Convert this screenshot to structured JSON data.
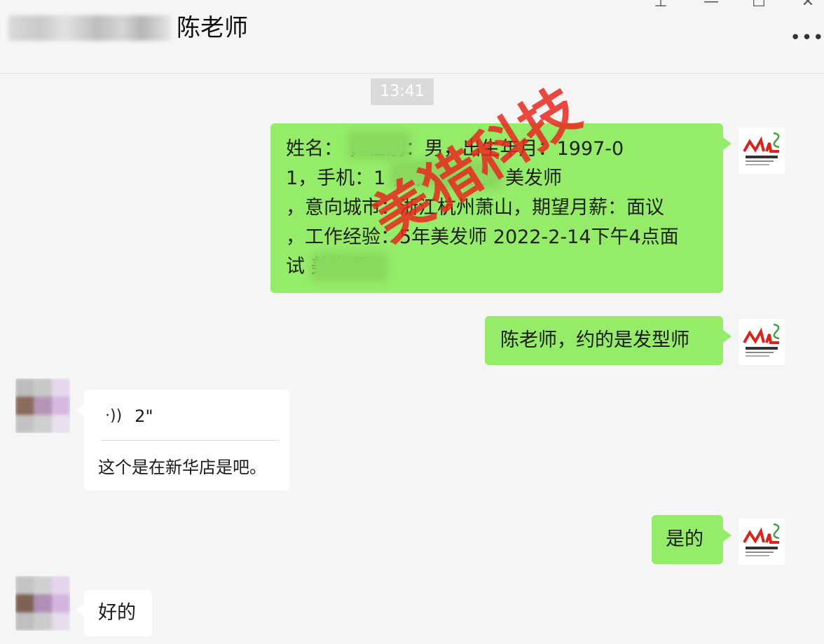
{
  "header": {
    "contact_name": "陈老师",
    "more_label": "•••",
    "controls": {
      "pin": "⊥",
      "minimize": "—",
      "maximize": "☐",
      "close": "✕"
    }
  },
  "timestamp": "13:41",
  "messages": [
    {
      "direction": "out",
      "lines": [
        "姓名：                ，性别：男，出生年月：1997-0",
        "1，手机：1                     ，求职岗位：美发师",
        "，意向城市：浙江杭州萧山，期望月薪：面议",
        "，工作经验：5年美发师 2022-2-14下午4点面",
        "试             美发师"
      ]
    },
    {
      "direction": "out",
      "text": "陈老师，约的是发型师"
    },
    {
      "direction": "in",
      "voice_duration": "2\"",
      "transcript": "这个是在新华店是吧。"
    },
    {
      "direction": "out",
      "text": "是的"
    },
    {
      "direction": "in",
      "text": "好的"
    }
  ],
  "watermark": "美猎科技",
  "colors": {
    "outgoing_bubble": "#95ec69",
    "incoming_bubble": "#ffffff",
    "background": "#f5f5f5",
    "watermark": "#e8281e"
  },
  "icons": {
    "voice": "voice-wave-icon",
    "logo": "ml-logo-icon"
  }
}
